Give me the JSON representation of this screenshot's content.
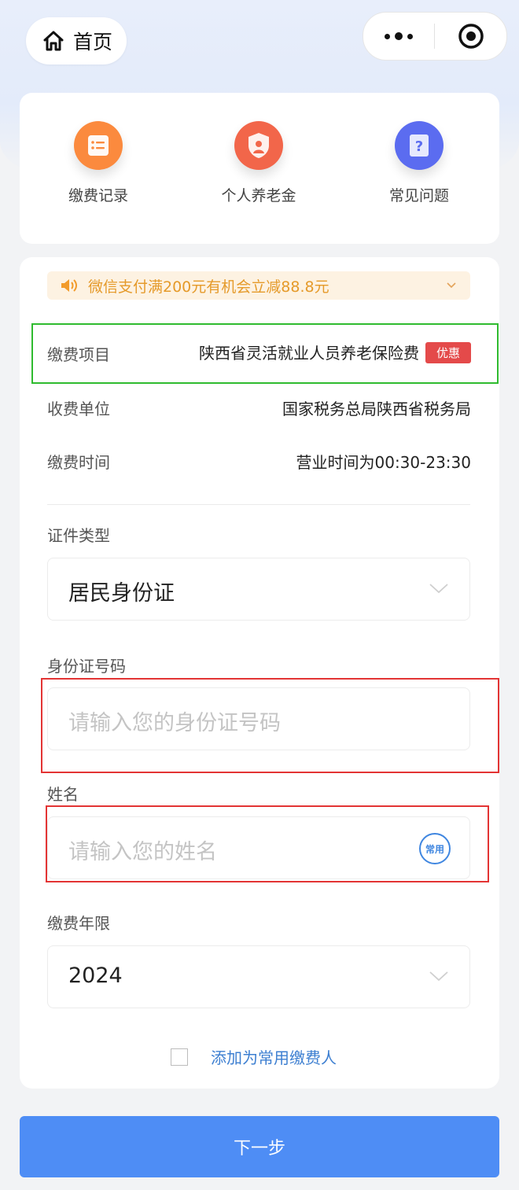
{
  "nav": {
    "home_label": "首页"
  },
  "quick_links": [
    {
      "label": "缴费记录",
      "icon": "receipt-list-icon",
      "color": "#fb8a3e"
    },
    {
      "label": "个人养老金",
      "icon": "shield-person-icon",
      "color": "#f2664a"
    },
    {
      "label": "常见问题",
      "icon": "question-doc-icon",
      "color": "#5b6cf0"
    }
  ],
  "notice": {
    "text": "微信支付满200元有机会立减88.8元"
  },
  "info": {
    "item_label": "缴费项目",
    "item_value": "陕西省灵活就业人员养老保险费",
    "item_badge": "优惠",
    "unit_label": "收费单位",
    "unit_value": "国家税务总局陕西省税务局",
    "time_label": "缴费时间",
    "time_value": "营业时间为00:30-23:30"
  },
  "form": {
    "id_type_label": "证件类型",
    "id_type_value": "居民身份证",
    "id_number_label": "身份证号码",
    "id_number_placeholder": "请输入您的身份证号码",
    "name_label": "姓名",
    "name_placeholder": "请输入您的姓名",
    "name_badge": "常用",
    "year_label": "缴费年限",
    "year_value": "2024",
    "add_common_label": "添加为常用缴费人"
  },
  "next_button": "下一步"
}
